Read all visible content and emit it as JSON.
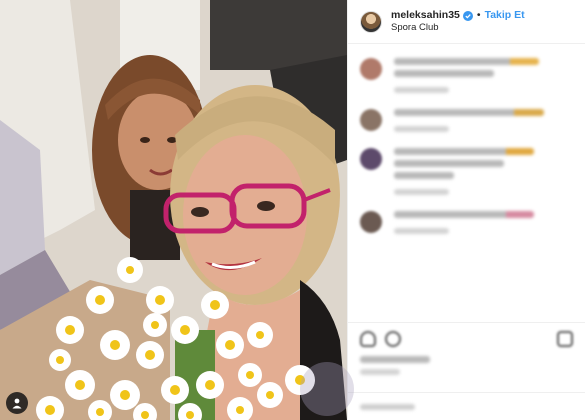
{
  "post": {
    "author": {
      "username": "meleksahin35",
      "verified": true,
      "follow_label": "Takip Et",
      "separator": "•",
      "location": "Spora Club"
    },
    "photo": {
      "subjects": "two women in a selfie, one with red glasses holding a bouquet of white daisies",
      "user_tag_icon": "person-icon"
    },
    "comments": [
      {
        "blurred": true,
        "avatar_color": "#b07a6a",
        "line_widths": [
          145,
          100
        ],
        "accent": "#e6b34d"
      },
      {
        "blurred": true,
        "avatar_color": "#8a7466",
        "line_widths": [
          150
        ],
        "accent": "#d9a94a"
      },
      {
        "blurred": true,
        "avatar_color": "#5d4a6b",
        "line_widths": [
          140,
          110,
          60
        ],
        "accent": "#e0a840"
      },
      {
        "blurred": true,
        "avatar_color": "#6b5a52",
        "line_widths": [
          140
        ],
        "accent": "#d68aa0"
      }
    ],
    "actions": {
      "icons": [
        "heart-icon",
        "comment-icon",
        "share-icon"
      ],
      "save_icon": "bookmark-icon"
    },
    "colors": {
      "accent_blue": "#3897f0",
      "border": "#efefef",
      "text": "#262626"
    }
  }
}
